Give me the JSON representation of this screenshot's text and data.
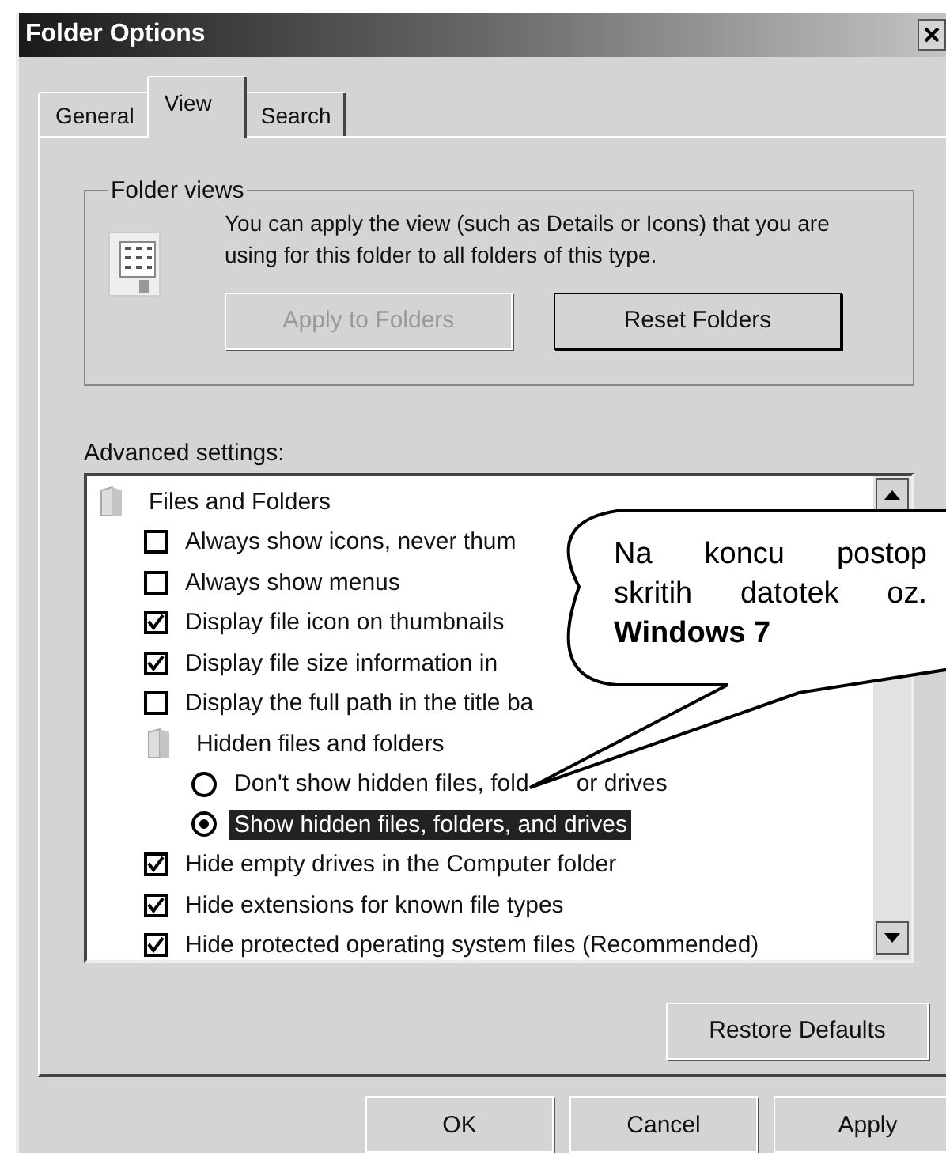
{
  "window": {
    "title": "Folder Options"
  },
  "tabs": [
    {
      "label": "General",
      "selected": false
    },
    {
      "label": "View",
      "selected": true
    },
    {
      "label": "Search",
      "selected": false
    }
  ],
  "folder_views": {
    "legend": "Folder views",
    "description": "You can apply the view (such as Details or Icons) that you are using for this folder to all folders of this type.",
    "buttons": [
      {
        "label": "Apply to Folders",
        "disabled": true
      },
      {
        "label": "Reset Folders",
        "disabled": false
      }
    ]
  },
  "advanced": {
    "label": "Advanced settings:",
    "items": [
      {
        "kind": "group",
        "label": "Files and Folders",
        "children": [
          {
            "kind": "checkbox",
            "label": "Always show icons, never thum",
            "checked": false
          },
          {
            "kind": "checkbox",
            "label": "Always show menus",
            "checked": false
          },
          {
            "kind": "checkbox",
            "label": "Display file icon on thumbnails",
            "checked": true
          },
          {
            "kind": "checkbox",
            "label": "Display file size information in",
            "checked": true
          },
          {
            "kind": "checkbox",
            "label": "Display the full path in the title ba",
            "checked": false
          },
          {
            "kind": "group",
            "label": "Hidden files and folders",
            "children": [
              {
                "kind": "radio",
                "label": "Don't show hidden files, fold",
                "label_after": "or drives",
                "selected": false
              },
              {
                "kind": "radio",
                "label": "Show hidden files, folders, and drives",
                "selected": true
              }
            ]
          },
          {
            "kind": "checkbox",
            "label": "Hide empty drives in the Computer folder",
            "checked": true
          },
          {
            "kind": "checkbox",
            "label": "Hide extensions for known file types",
            "checked": true
          },
          {
            "kind": "checkbox",
            "label": "Hide protected operating system files (Recommended)",
            "checked": true
          }
        ]
      }
    ],
    "restore_button": "Restore Defaults"
  },
  "callout": {
    "lines": [
      {
        "text": "Na koncu postop",
        "bold": false
      },
      {
        "text": "skritih datotek oz.",
        "bold": false
      },
      {
        "text": "Windows 7",
        "bold": true
      }
    ]
  },
  "buttons": [
    "OK",
    "Cancel",
    "Apply"
  ]
}
